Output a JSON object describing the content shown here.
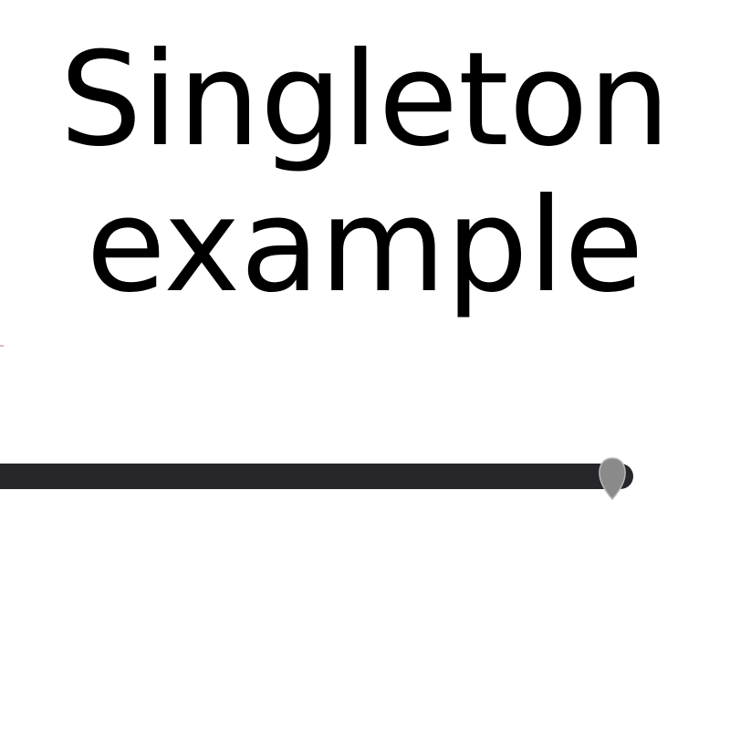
{
  "title": {
    "line1": "Singleton",
    "line2": "example"
  },
  "colors": {
    "bar": "#26262b",
    "marker_fill": "#8a8a8a",
    "marker_stroke": "#b8b8b8",
    "text": "#000000",
    "background": "#ffffff"
  },
  "marker": {
    "icon": "teardrop-marker-icon"
  }
}
